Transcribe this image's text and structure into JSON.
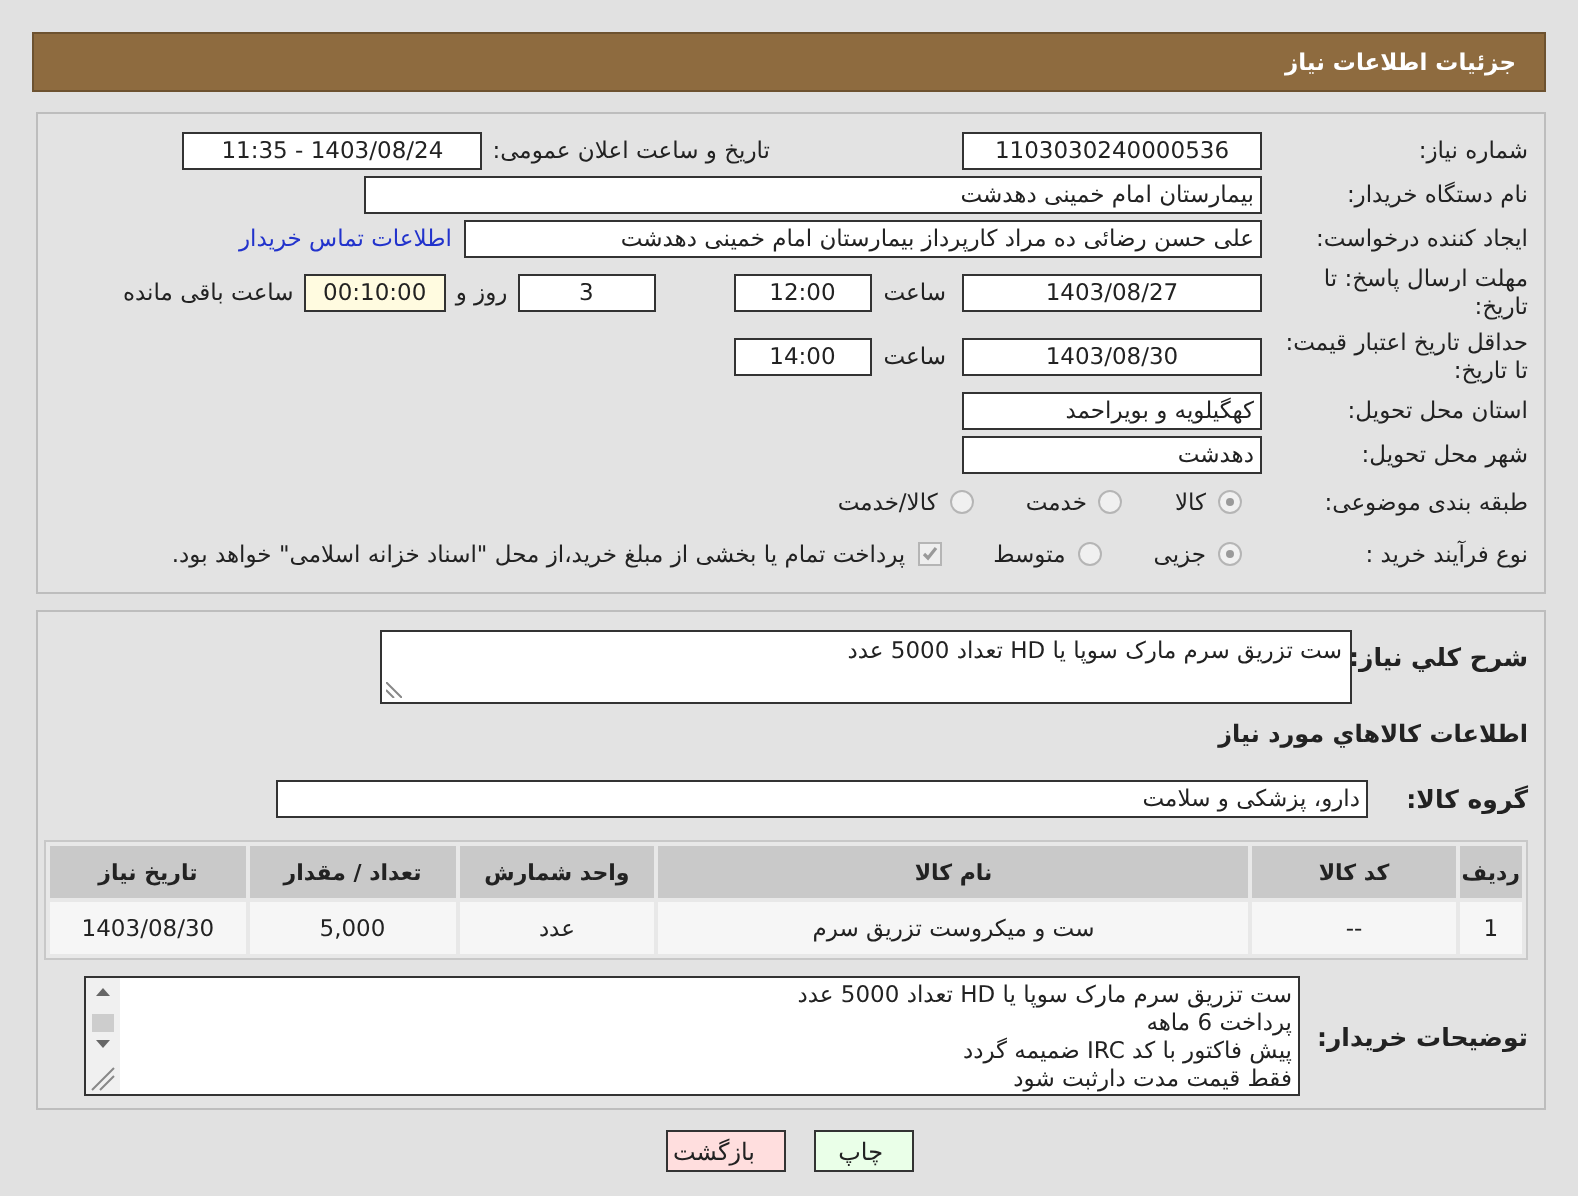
{
  "header": {
    "title": "جزئیات اطلاعات نیاز"
  },
  "details": {
    "need_number": {
      "label": "شماره نیاز:",
      "value": "1103030240000536"
    },
    "announce": {
      "label": "تاریخ و ساعت اعلان عمومی:",
      "value": "1403/08/24 - 11:35"
    },
    "buyer_org": {
      "label": "نام دستگاه خریدار:",
      "value": "بیمارستان امام خمینی دهدشت"
    },
    "requester": {
      "label": "ایجاد کننده درخواست:",
      "value": "علی حسن رضائی ده مراد کارپرداز بیمارستان امام خمینی دهدشت",
      "link": "اطلاعات تماس خریدار"
    },
    "reply_deadline": {
      "label": "مهلت ارسال پاسخ: تا تاریخ:",
      "date": "1403/08/27",
      "time_label": "ساعت",
      "time": "12:00",
      "days": "3",
      "days_label": "روز و",
      "remaining": "00:10:00",
      "remaining_label": "ساعت باقی مانده"
    },
    "price_validity": {
      "label": "حداقل تاریخ اعتبار قیمت: تا تاریخ:",
      "date": "1403/08/30",
      "time_label": "ساعت",
      "time": "14:00"
    },
    "province": {
      "label": "استان محل تحویل:",
      "value": "کهگیلویه و بویراحمد"
    },
    "city": {
      "label": "شهر محل تحویل:",
      "value": "دهدشت"
    },
    "category": {
      "label": "طبقه بندی موضوعی:",
      "options": [
        {
          "label": "کالا",
          "selected": true
        },
        {
          "label": "خدمت",
          "selected": false
        },
        {
          "label": "کالا/خدمت",
          "selected": false
        }
      ]
    },
    "process": {
      "label": "نوع فرآیند خرید :",
      "options": [
        {
          "label": "جزیی",
          "selected": true
        },
        {
          "label": "متوسط",
          "selected": false
        }
      ],
      "payment": {
        "label": "پرداخت تمام یا بخشی از مبلغ خرید،از محل \"اسناد خزانه اسلامی\" خواهد بود.",
        "checked": true
      }
    }
  },
  "need": {
    "description": {
      "label": "شرح كلي نياز:",
      "value": "ست تزریق سرم مارک سوپا یا HD تعداد 5000 عدد"
    },
    "section_title": "اطلاعات كالاهاي مورد نياز",
    "goods_group": {
      "label": "گروه کالا:",
      "value": "دارو، پزشکی و سلامت"
    },
    "table": {
      "columns": [
        "ردیف",
        "کد کالا",
        "نام کالا",
        "واحد شمارش",
        "تعداد / مقدار",
        "تاریخ نیاز"
      ],
      "rows": [
        [
          "1",
          "--",
          "ست و میکروست تزریق سرم",
          "عدد",
          "5,000",
          "1403/08/30"
        ]
      ]
    },
    "buyer_notes": {
      "label": "توضیحات خریدار:",
      "lines": [
        "ست تزریق سرم مارک سوپا یا HD تعداد 5000 عدد",
        "پرداخت 6 ماهه",
        "پیش فاکتور با کد IRC ضمیمه گردد",
        "فقط قیمت مدت دارثبت شود"
      ]
    }
  },
  "buttons": [
    {
      "label": "چاپ",
      "kind": "print"
    },
    {
      "label": "بازگشت",
      "kind": "back"
    }
  ]
}
